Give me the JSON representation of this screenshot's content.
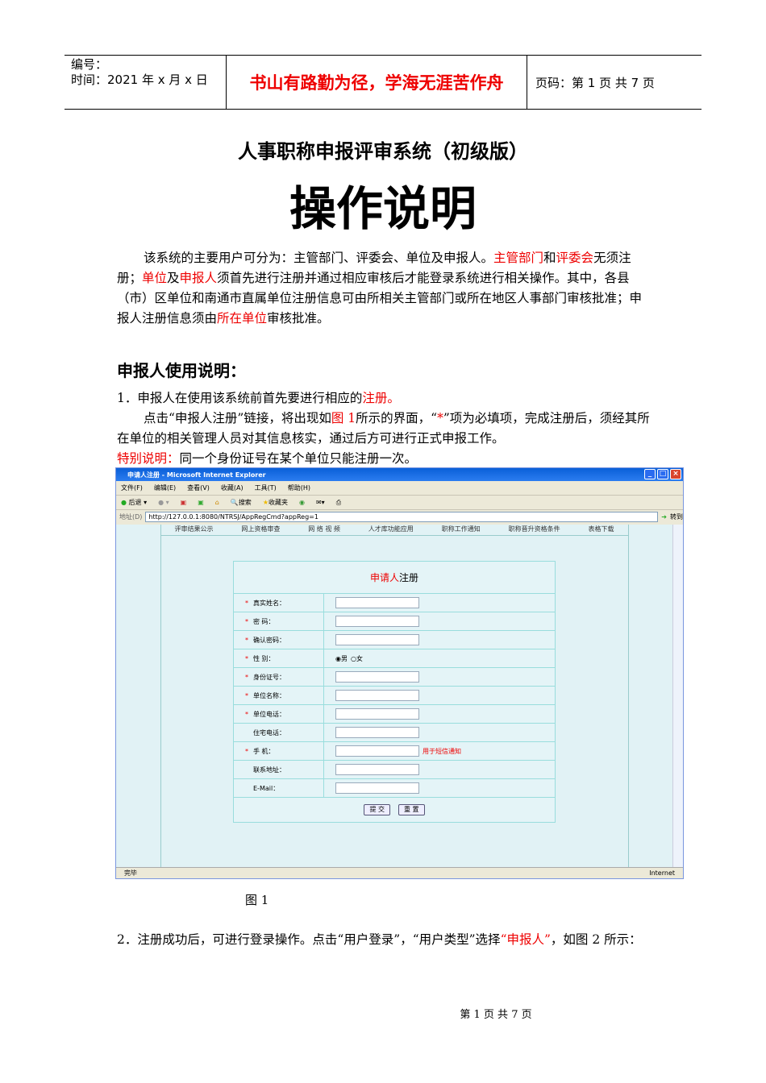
{
  "header": {
    "number_label": "编号：",
    "date_label": "时间：2021 年 x 月 x 日",
    "motto": "书山有路勤为径，学海无涯苦作舟",
    "page_info": "页码：第 1 页  共 7 页"
  },
  "subtitle": "人事职称申报评审系统（初级版）",
  "title": "操作说明",
  "intro": {
    "t1": "该系统的主要用户可分为：主管部门、评委会、单位及申报人。",
    "r1": "主管部门",
    "t2": "和",
    "r2": "评委会",
    "t3": "无须注册；",
    "r3": "单位",
    "t4": "及",
    "r4": "申报人",
    "t5": "须首先进行注册并通过相应审核后才能登录系统进行相关操作。其中，各县（市）区单位和南通市直属单位注册信息可由所相关主管部门或所在地区人事部门审核批准；申报人注册信息须由",
    "r5": "所在单位",
    "t6": "审核批准。"
  },
  "section_title": "申报人使用说明：",
  "step1": {
    "t1": "1．申报人在使用该系统前首先要进行相应的",
    "r1": "注册。"
  },
  "step1b": {
    "t1": "点击“申报人注册”链接，将出现如",
    "r1": "图 1",
    "t2": "所示的界面，“",
    "r2": "*",
    "t3": "”项为必填项，完成注册后，须经其所在单位的相关管理人员对其信息核实，通过后方可进行正式申报工作。"
  },
  "note": {
    "r1": "特别说明：",
    "t1": "同一个身份证号在某个单位只能注册一次。"
  },
  "browser": {
    "title": "申请人注册 - Microsoft Internet Explorer",
    "menu": [
      "文件(F)",
      "编辑(E)",
      "查看(V)",
      "收藏(A)",
      "工具(T)",
      "帮助(H)"
    ],
    "toolbar": {
      "back": "后退",
      "search": "搜索",
      "favorites": "收藏夹"
    },
    "address_label": "地址(D)",
    "url": "http://127.0.0.1:8080/NTRSJ/AppRegCmd?appReg=1",
    "go": "转到",
    "nav": [
      "评审结果公示",
      "网上资格审查",
      "网 络 视 频",
      "人才库功能应用",
      "职称工作通知",
      "职称晋升资格条件",
      "表格下载"
    ],
    "form": {
      "title_red": "申请人",
      "title_rest": "注册",
      "fields": [
        {
          "label": "真实姓名：",
          "req": true
        },
        {
          "label": "密  码：",
          "req": true
        },
        {
          "label": "确认密码：",
          "req": true
        },
        {
          "label": "性  别：",
          "req": true,
          "radio": true
        },
        {
          "label": "身份证号：",
          "req": true
        },
        {
          "label": "单位名称：",
          "req": true
        },
        {
          "label": "单位电话：",
          "req": true
        },
        {
          "label": "住宅电话：",
          "req": false
        },
        {
          "label": "手  机：",
          "req": true,
          "hint": "用于短信通知"
        },
        {
          "label": "联系地址：",
          "req": false
        },
        {
          "label": "E-Mail：",
          "req": false
        }
      ],
      "male": "男",
      "female": "女",
      "submit": "提 交",
      "reset": "重 置"
    },
    "status_left": "完毕",
    "status_right": "Internet"
  },
  "caption": "图 1",
  "step2": {
    "t1": "2．注册成功后，可进行登录操作。点击“用户登录”，“用户类型”选择",
    "r1": "“申报人”",
    "t2": "，如图 2 所示："
  },
  "footer": "第  1  页  共  7  页"
}
